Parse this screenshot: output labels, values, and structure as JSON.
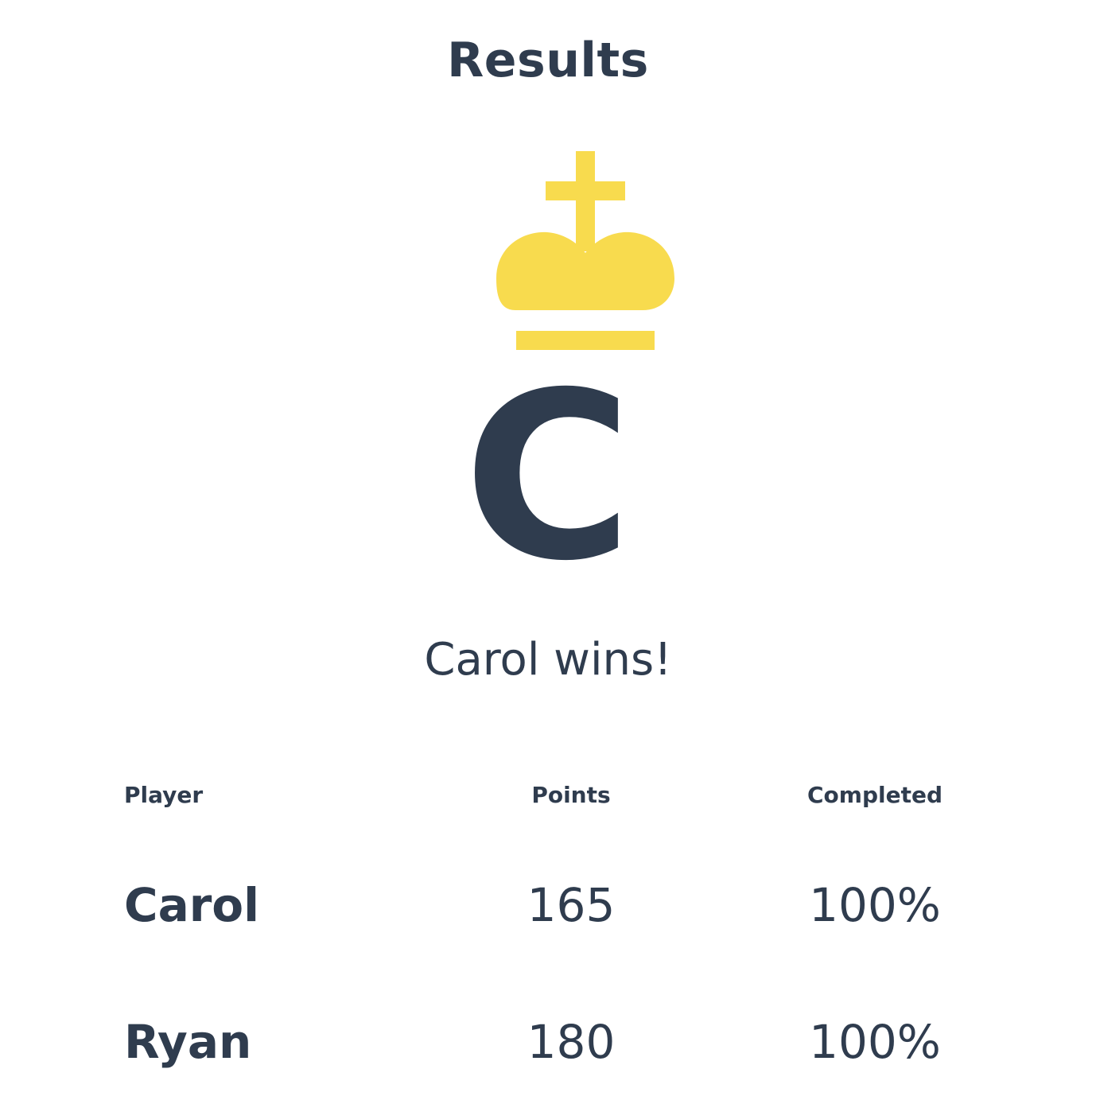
{
  "header": {
    "title": "Results"
  },
  "winner": {
    "icon": "crown-icon",
    "initial": "C",
    "message": "Carol wins!"
  },
  "table": {
    "columns": {
      "player": "Player",
      "points": "Points",
      "completed": "Completed"
    },
    "rows": [
      {
        "player": "Carol",
        "points": "165",
        "completed": "100%"
      },
      {
        "player": "Ryan",
        "points": "180",
        "completed": "100%"
      }
    ]
  },
  "colors": {
    "text": "#2f3c4e",
    "crown": "#f8db4e",
    "background": "#ffffff"
  }
}
